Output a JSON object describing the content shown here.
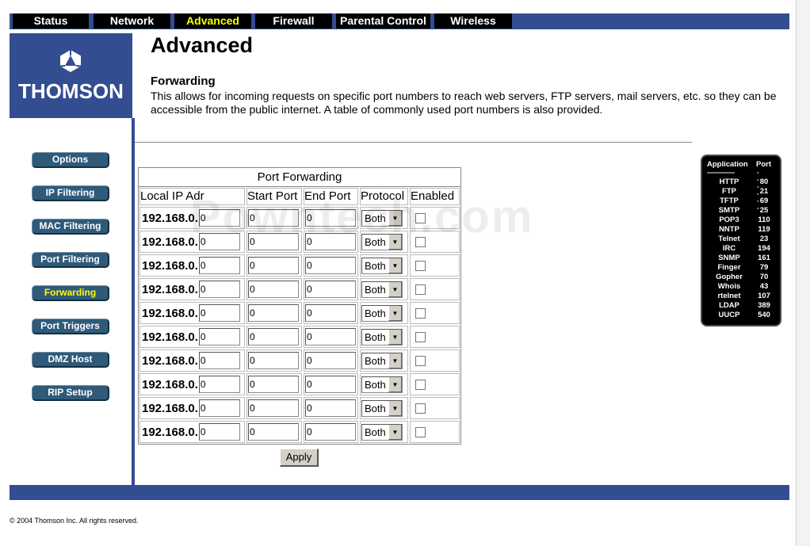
{
  "nav": {
    "tabs": [
      {
        "label": "Status",
        "active": false
      },
      {
        "label": "Network",
        "active": false
      },
      {
        "label": "Advanced",
        "active": true
      },
      {
        "label": "Firewall",
        "active": false
      },
      {
        "label": "Parental Control",
        "active": false
      },
      {
        "label": "Wireless",
        "active": false
      }
    ]
  },
  "brand": {
    "logo_text": "THOMSON",
    "icon": "thomson-logo-icon"
  },
  "sidebar": {
    "items": [
      {
        "label": "Options",
        "active": false
      },
      {
        "label": "IP Filtering",
        "active": false
      },
      {
        "label": "MAC Filtering",
        "active": false
      },
      {
        "label": "Port Filtering",
        "active": false
      },
      {
        "label": "Forwarding",
        "active": true
      },
      {
        "label": "Port Triggers",
        "active": false
      },
      {
        "label": "DMZ Host",
        "active": false
      },
      {
        "label": "RIP Setup",
        "active": false
      }
    ]
  },
  "page": {
    "title": "Advanced",
    "section_title": "Forwarding",
    "description": "This allows for incoming requests on specific port numbers to reach  web servers, FTP servers, mail servers, etc. so they can be accessible from the public internet.  A table of commonly used port numbers is also provided."
  },
  "watermark": "Powntech.com",
  "table": {
    "caption": "Port Forwarding",
    "headers": {
      "ip": "Local IP Adr",
      "start": "Start Port",
      "end": "End Port",
      "protocol": "Protocol",
      "enabled": "Enabled"
    },
    "ip_prefix": "192.168.0.",
    "rows": [
      {
        "ip": "0",
        "start": "0",
        "end": "0",
        "protocol": "Both",
        "enabled": false
      },
      {
        "ip": "0",
        "start": "0",
        "end": "0",
        "protocol": "Both",
        "enabled": false
      },
      {
        "ip": "0",
        "start": "0",
        "end": "0",
        "protocol": "Both",
        "enabled": false
      },
      {
        "ip": "0",
        "start": "0",
        "end": "0",
        "protocol": "Both",
        "enabled": false
      },
      {
        "ip": "0",
        "start": "0",
        "end": "0",
        "protocol": "Both",
        "enabled": false
      },
      {
        "ip": "0",
        "start": "0",
        "end": "0",
        "protocol": "Both",
        "enabled": false
      },
      {
        "ip": "0",
        "start": "0",
        "end": "0",
        "protocol": "Both",
        "enabled": false
      },
      {
        "ip": "0",
        "start": "0",
        "end": "0",
        "protocol": "Both",
        "enabled": false
      },
      {
        "ip": "0",
        "start": "0",
        "end": "0",
        "protocol": "Both",
        "enabled": false
      },
      {
        "ip": "0",
        "start": "0",
        "end": "0",
        "protocol": "Both",
        "enabled": false
      }
    ],
    "apply_label": "Apply"
  },
  "ports_panel": {
    "header_app": "Application",
    "header_port": "Port",
    "dash_app": "----------------",
    "dash_port": "------",
    "rows": [
      {
        "app": "HTTP",
        "port": "80"
      },
      {
        "app": "FTP",
        "port": "21"
      },
      {
        "app": "TFTP",
        "port": "69"
      },
      {
        "app": "SMTP",
        "port": "25"
      },
      {
        "app": "POP3",
        "port": "110"
      },
      {
        "app": "NNTP",
        "port": "119"
      },
      {
        "app": "Telnet",
        "port": "23"
      },
      {
        "app": "IRC",
        "port": "194"
      },
      {
        "app": "SNMP",
        "port": "161"
      },
      {
        "app": "Finger",
        "port": "79"
      },
      {
        "app": "Gopher",
        "port": "70"
      },
      {
        "app": "Whois",
        "port": "43"
      },
      {
        "app": "rtelnet",
        "port": "107"
      },
      {
        "app": "LDAP",
        "port": "389"
      },
      {
        "app": "UUCP",
        "port": "540"
      }
    ]
  },
  "footer": {
    "copyright": "© 2004 Thomson Inc.  All rights reserved."
  },
  "colors": {
    "brand_blue": "#334d91",
    "button_blue": "#2f5a7a",
    "active_yellow": "#ffff00"
  }
}
